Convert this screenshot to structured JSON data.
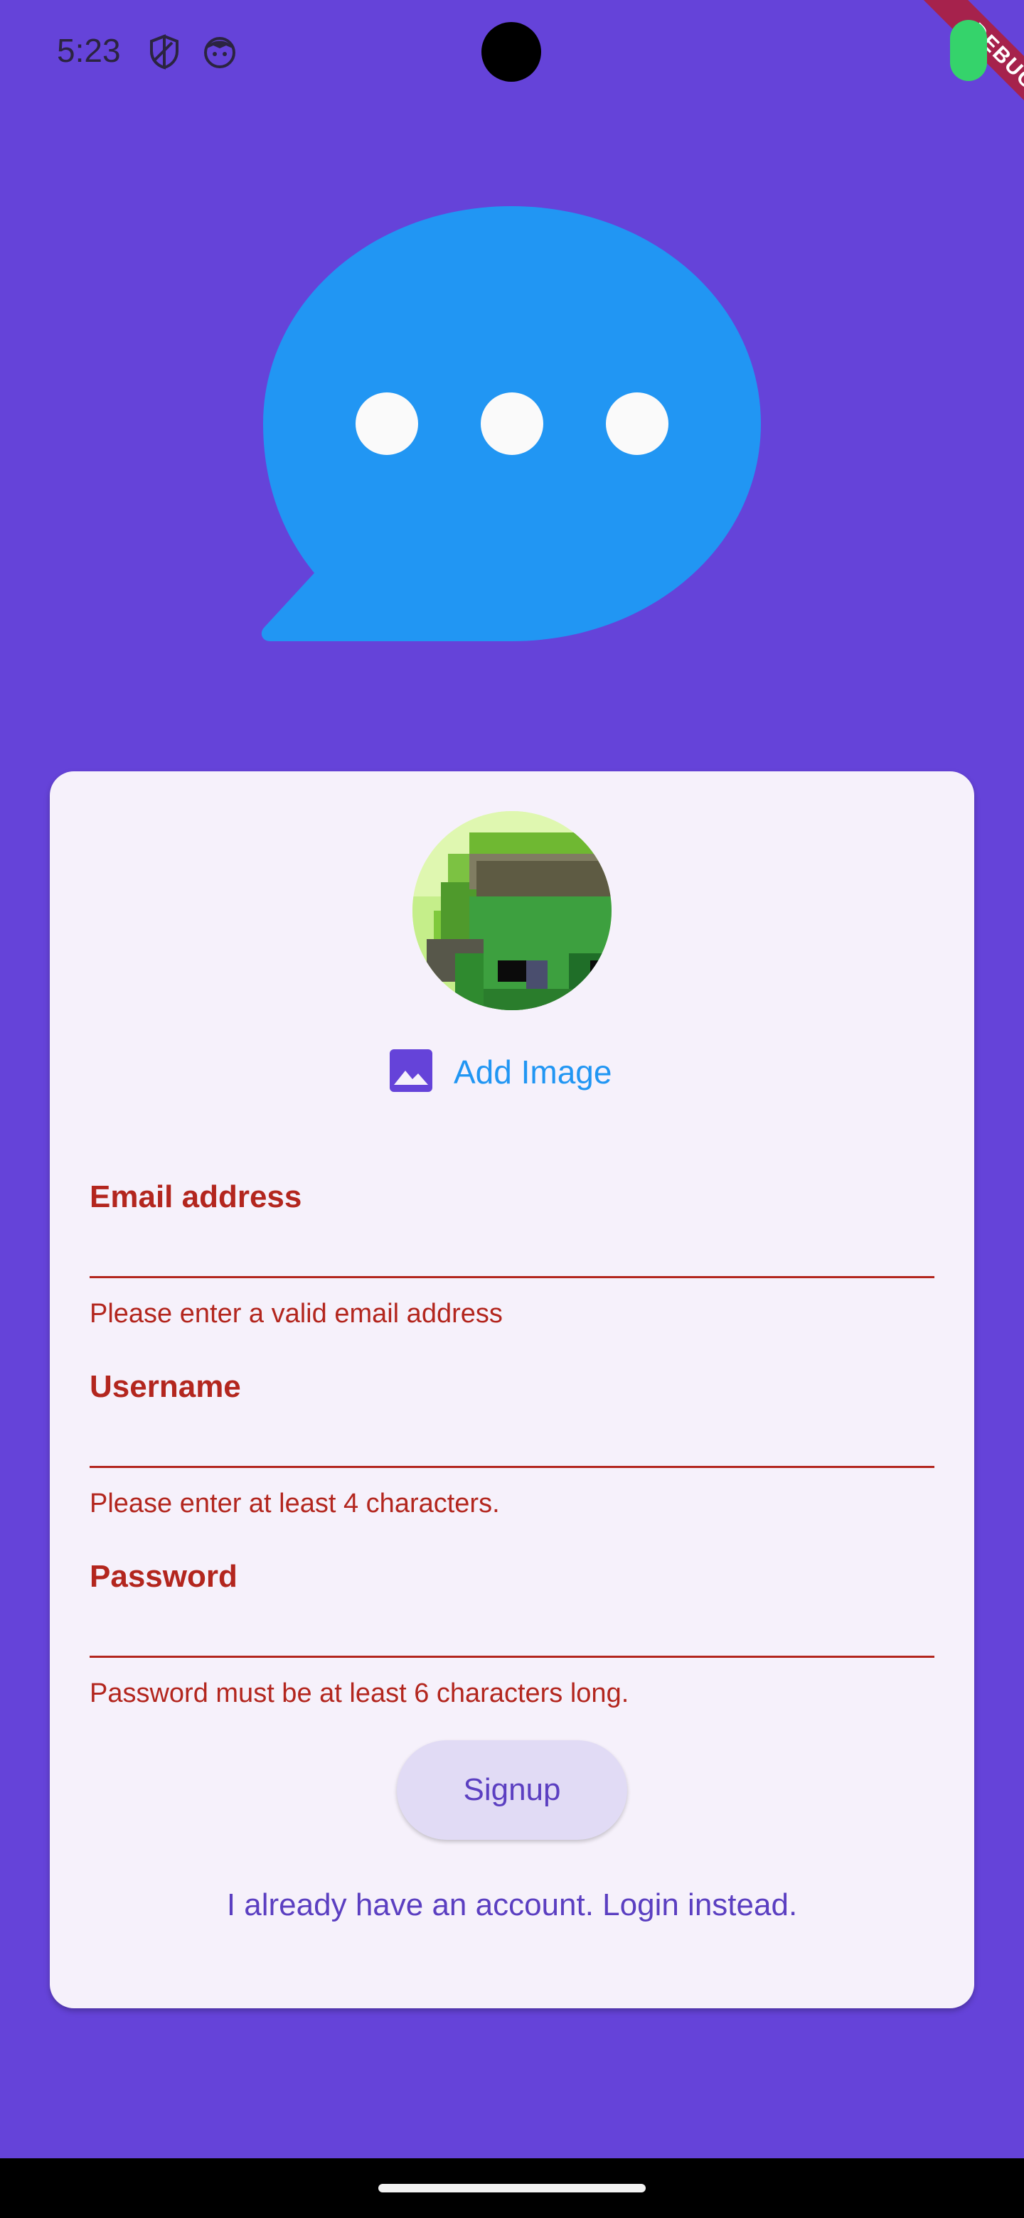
{
  "status_bar": {
    "time": "5:23",
    "icons": [
      "shield-icon",
      "face-icon"
    ],
    "debug_banner": "DEBUG"
  },
  "logo": {
    "icon": "chat-bubble-icon",
    "bubble_color": "#2196f3",
    "dot_color": "#ffffff"
  },
  "signup_form": {
    "avatar_icon": "pixel-avatar-image",
    "add_image_label": "Add Image",
    "fields": {
      "email": {
        "label": "Email address",
        "value": "",
        "error": "Please enter a valid email address"
      },
      "username": {
        "label": "Username",
        "value": "",
        "error": "Please enter at least 4 characters."
      },
      "password": {
        "label": "Password",
        "value": "",
        "error": "Password must be at least 6 characters long."
      }
    },
    "signup_label": "Signup",
    "login_link": "I already have an account. Login instead."
  },
  "colors": {
    "background": "#6543d9",
    "card": "#f6f1fb",
    "error": "#b3261e",
    "accent": "#5b3fc1",
    "link_blue": "#2196f3"
  }
}
